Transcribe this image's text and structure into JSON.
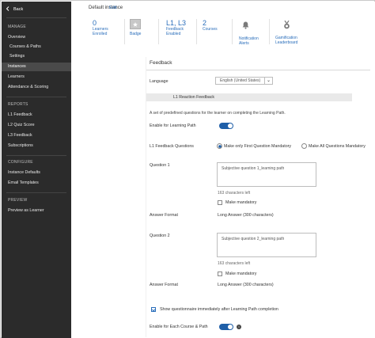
{
  "sidebar": {
    "back_label": "Back",
    "sections": [
      {
        "title": "MANAGE",
        "items": [
          "Overview",
          "Courses & Paths",
          "Settings",
          "Instances",
          "Learners",
          "Attendance & Scoring"
        ]
      },
      {
        "title": "REPORTS",
        "items": [
          "L1 Feedback",
          "L2 Quiz Score",
          "L3 Feedback",
          "Subscriptions"
        ]
      },
      {
        "title": "CONFIGURE",
        "items": [
          "Instance Defaults",
          "Email Templates"
        ]
      },
      {
        "title": "PREVIEW",
        "items": [
          "Preview as Learner"
        ]
      }
    ]
  },
  "header": {
    "instance_title": "Default instance",
    "edit_label": "Edit"
  },
  "stats": [
    {
      "value": "0",
      "label1": "Learners",
      "label2": "Enrolled"
    },
    {
      "value": "",
      "label1": "Badge",
      "label2": ""
    },
    {
      "value": "L1, L3",
      "label1": "Feedback",
      "label2": "Enabled"
    },
    {
      "value": "2",
      "label1": "Courses",
      "label2": ""
    },
    {
      "value": "",
      "label1": "Notification",
      "label2": "Alerts"
    },
    {
      "value": "",
      "label1": "Gamification",
      "label2": "Leaderboard"
    }
  ],
  "feedback": {
    "title": "Feedback",
    "language_label": "Language",
    "language_value": "English (United States)",
    "section_title": "L1 Reaction Feedback",
    "description": "A set of predefined questions for the learner on completing the Learning Path.",
    "enable_label": "Enable for Learning Path",
    "questions_label": "L1 Feedback Questions",
    "radio1": "Make only First Question Mandatory",
    "radio2": "Make All Questions Mandatory",
    "q1_label": "Question 1",
    "q1_value": "Subjective question 1_learning path",
    "q1_chars": "163 characters left",
    "q1_mandatory": "Make mandatory",
    "answer_format_label": "Answer Format",
    "answer_format_value": "Long Answer (300 characters)",
    "q2_label": "Question 2",
    "q2_value": "Subjective question 2_learning path",
    "q2_chars": "163 characters left",
    "q2_mandatory": "Make mandatory",
    "answer2_format_label": "Answer Format",
    "answer2_format_value": "Long Answer (300 characters)",
    "show_after_label": "Show questionnaire immediately after Learning Path completion",
    "enable_each_label": "Enable for Each Course & Path"
  },
  "colors": {
    "sidebar_bg": "#2b2b2b",
    "accent": "#2a6ebb",
    "toggle": "#1f5fa8"
  }
}
